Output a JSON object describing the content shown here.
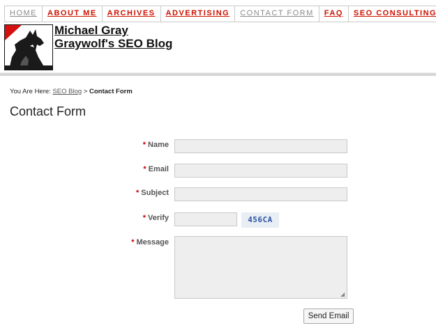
{
  "nav": {
    "items": [
      {
        "label": "HOME",
        "muted": true
      },
      {
        "label": "ABOUT ME",
        "muted": false
      },
      {
        "label": "ARCHIVES",
        "muted": false
      },
      {
        "label": "ADVERTISING",
        "muted": false
      },
      {
        "label": "CONTACT FORM",
        "muted": true
      },
      {
        "label": "FAQ",
        "muted": false
      },
      {
        "label": "SEO CONSULTING",
        "muted": false
      }
    ]
  },
  "header": {
    "author": "Michael Gray",
    "blog_title": "Graywolf's SEO Blog",
    "logo_icon": "howling-wolf-icon"
  },
  "breadcrumb": {
    "prefix": "You Are Here:",
    "link": "SEO Blog",
    "separator": ">",
    "current": "Contact Form"
  },
  "page": {
    "title": "Contact Form"
  },
  "form": {
    "required_marker": "*",
    "name_label": "Name",
    "email_label": "Email",
    "subject_label": "Subject",
    "verify_label": "Verify",
    "captcha_code": "456CA",
    "message_label": "Message",
    "submit_label": "Send Email"
  },
  "colors": {
    "nav_link": "#cc1100",
    "required": "#cc0000",
    "field_bg": "#eeeeee",
    "captcha_text": "#2a53a3"
  }
}
